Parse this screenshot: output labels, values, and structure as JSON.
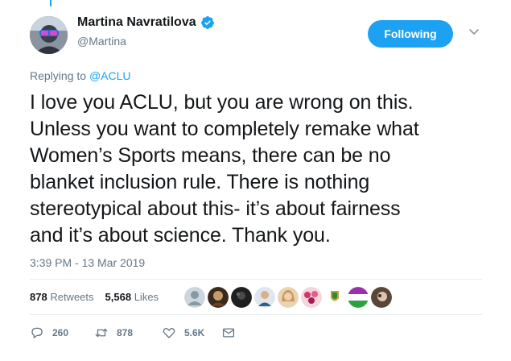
{
  "author": {
    "display_name": "Martina Navratilova",
    "handle": "@Martina",
    "avatar_icon": "user-avatar",
    "verified_icon": "verified-badge-icon"
  },
  "follow_button": {
    "label": "Following"
  },
  "menu_icon": "chevron-down-icon",
  "reply_context": {
    "prefix": "Replying to ",
    "target": "@ACLU"
  },
  "tweet": {
    "text": "I love you ACLU, but you are wrong on this.\nUnless you want to completely remake what\nWomen’s Sports means, there can be no\nblanket inclusion rule. There is nothing\nstereotypical about this- it’s about fairness\nand it’s about science. Thank you.",
    "timestamp": "3:39 PM - 13 Mar 2019"
  },
  "stats": {
    "retweets_count": "878",
    "retweets_label": "Retweets",
    "likes_count": "5,568",
    "likes_label": "Likes"
  },
  "liker_avatars": [
    "default-avatar",
    "portrait-avatar",
    "dark-avatar",
    "person-avatar",
    "blonde-avatar",
    "flowers-avatar",
    "emblem-avatar",
    "flag-avatar",
    "photo-avatar"
  ],
  "actions": {
    "reply_count": "260",
    "retweet_count": "878",
    "like_count": "5.6K"
  },
  "colors": {
    "accent": "#1da1f2",
    "text": "#14171a",
    "muted": "#657786",
    "divider": "#e6ecf0"
  }
}
